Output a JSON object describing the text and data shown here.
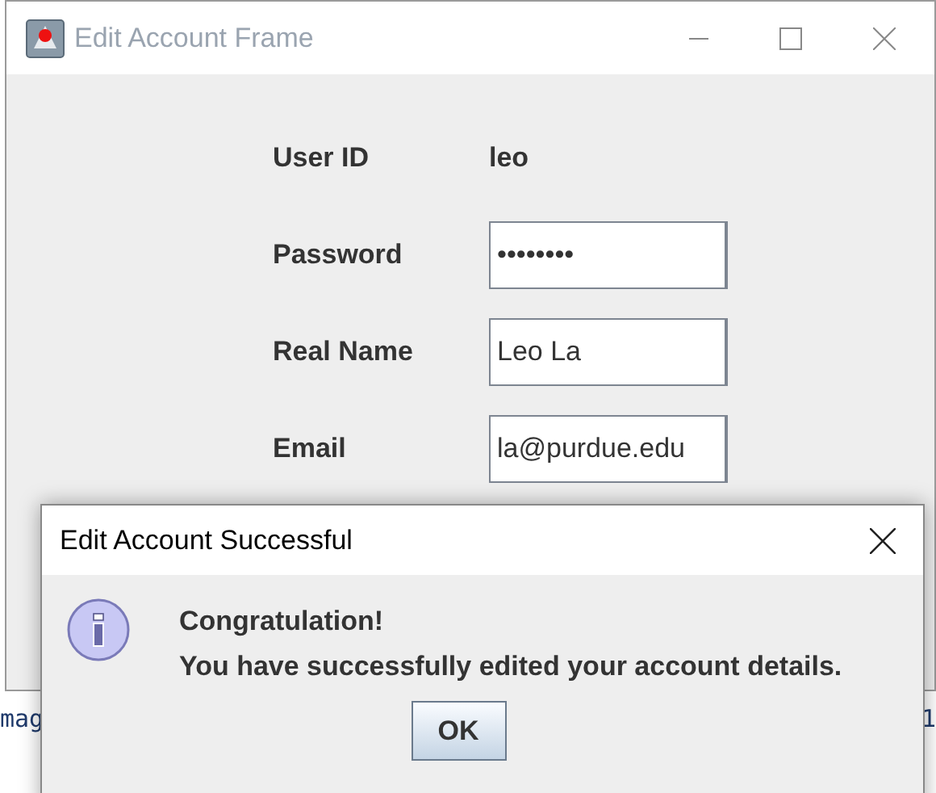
{
  "background_text": [
    "mag",
    "1"
  ],
  "window": {
    "title": "Edit Account Frame",
    "fields": [
      {
        "kind": "label",
        "label": "User ID",
        "value": "leo"
      },
      {
        "kind": "input",
        "label": "Password",
        "value": "••••••••"
      },
      {
        "kind": "input",
        "label": "Real Name",
        "value": "Leo La"
      },
      {
        "kind": "input",
        "label": "Email",
        "value": "la@purdue.edu"
      }
    ]
  },
  "dialog": {
    "title": "Edit Account Successful",
    "heading": "Congratulation!",
    "message": "You have successfully edited your account details.",
    "button": "OK"
  }
}
